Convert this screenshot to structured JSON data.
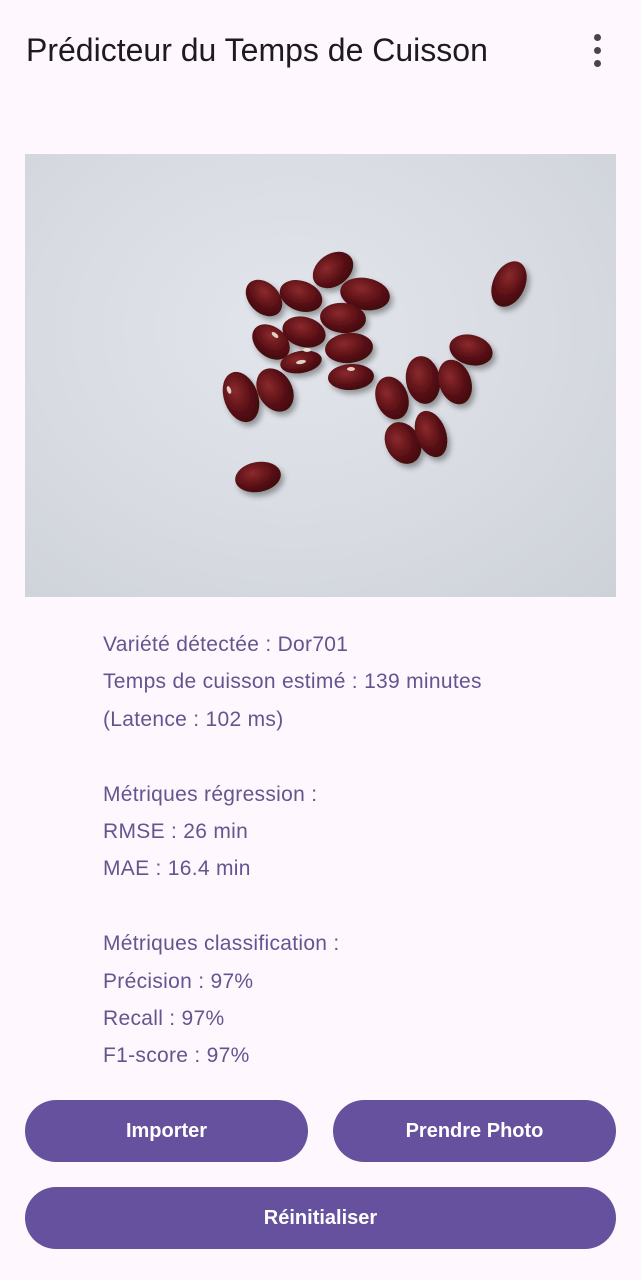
{
  "app_bar": {
    "title": "Prédicteur du Temps de Cuisson",
    "menu_icon": "more-vert-icon"
  },
  "photo": {
    "subject": "red kidney beans on white surface",
    "bean_color": "#5E1216",
    "background_color": "#DADEE4"
  },
  "results": {
    "variety": "Variété détectée : Dor701",
    "cooking_time": "Temps de cuisson estimé : 139 minutes",
    "latency": "(Latence : 102 ms)",
    "regression_header": "Métriques régression :",
    "rmse": "RMSE : 26 min",
    "mae": "MAE : 16.4 min",
    "classification_header": "Métriques classification :",
    "precision": "Précision : 97%",
    "recall": "Recall : 97%",
    "f1": "F1-score : 97%"
  },
  "buttons": {
    "import_label": "Importer",
    "take_photo_label": "Prendre Photo",
    "reset_label": "Réinitialiser"
  },
  "colors": {
    "background": "#FEF7FE",
    "accent": "#66519E",
    "result_text": "#65558F",
    "title_text": "#1D1B20"
  }
}
